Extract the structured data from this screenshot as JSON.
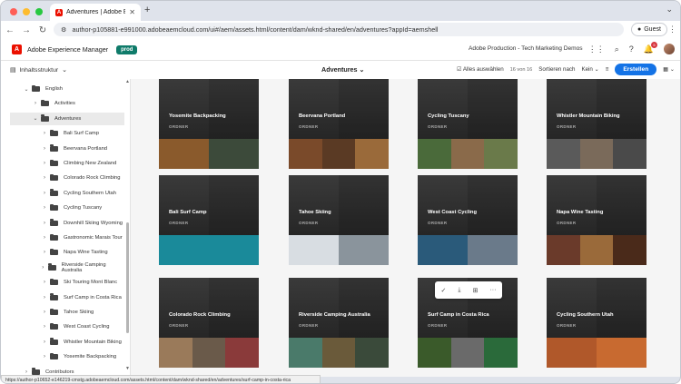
{
  "browser": {
    "tab_title": "Adventures | Adobe Experience",
    "url": "author-p105881-e991000.adobeaemcloud.com/ui#/aem/assets.html/content/dam/wknd-shared/en/adventures?appId=aemshell",
    "profile_label": "Guest"
  },
  "header": {
    "app_title": "Adobe Experience Manager",
    "env_badge": "prod",
    "org_name": "Adobe Production - Tech Marketing Demos",
    "notifications_count": "5"
  },
  "actionbar": {
    "rail_label": "Inhaltsstruktur",
    "breadcrumb": "Adventures",
    "select_all": "Alles auswählen",
    "count": "16 von 16",
    "sort_label": "Sortieren nach",
    "sort_value": "Kein",
    "create_label": "Erstellen"
  },
  "tree": {
    "items": [
      {
        "label": "English",
        "level": 1,
        "expanded": true
      },
      {
        "label": "Activities",
        "level": 2,
        "expanded": false
      },
      {
        "label": "Adventures",
        "level": 2,
        "expanded": true,
        "selected": true
      },
      {
        "label": "Bali Surf Camp",
        "level": 3
      },
      {
        "label": "Beervana Portland",
        "level": 3
      },
      {
        "label": "Climbing New Zealand",
        "level": 3
      },
      {
        "label": "Colorado Rock Climbing",
        "level": 3
      },
      {
        "label": "Cycling Southern Utah",
        "level": 3
      },
      {
        "label": "Cycling Tuscany",
        "level": 3
      },
      {
        "label": "Downhill Skiing Wyoming",
        "level": 3
      },
      {
        "label": "Gastronomic Marais Tour",
        "level": 3
      },
      {
        "label": "Napa Wine Tasting",
        "level": 3
      },
      {
        "label": "Riverside Camping Australia",
        "level": 3
      },
      {
        "label": "Ski Touring Mont Blanc",
        "level": 3
      },
      {
        "label": "Surf Camp in Costa Rica",
        "level": 3
      },
      {
        "label": "Tahoe Skiing",
        "level": 3
      },
      {
        "label": "West Coast Cycling",
        "level": 3
      },
      {
        "label": "Whistler Mountain Biking",
        "level": 3
      },
      {
        "label": "Yosemite Backpacking",
        "level": 3
      },
      {
        "label": "Contributors",
        "level": 1
      }
    ]
  },
  "cards": [
    {
      "name": "Yosemite Backpacking",
      "type": "ORDNER",
      "colors": [
        "#8a5a2c",
        "#3c4a3a"
      ]
    },
    {
      "name": "Beervana Portland",
      "type": "ORDNER",
      "colors": [
        "#7a4a2a",
        "#5a3a24",
        "#9a6a3a"
      ]
    },
    {
      "name": "Cycling Tuscany",
      "type": "ORDNER",
      "colors": [
        "#4a6a3a",
        "#8a6a4a",
        "#6a7a4a"
      ]
    },
    {
      "name": "Whistler Mountain Biking",
      "type": "ORDNER",
      "colors": [
        "#5a5a5a",
        "#7a6a5a",
        "#4a4a4a"
      ]
    },
    {
      "name": "Bali Surf Camp",
      "type": "ORDNER",
      "colors": [
        "#1a8a9a"
      ]
    },
    {
      "name": "Tahoe Skiing",
      "type": "ORDNER",
      "colors": [
        "#d8dde2",
        "#8a949c"
      ]
    },
    {
      "name": "West Coast Cycling",
      "type": "ORDNER",
      "colors": [
        "#2a5a7a",
        "#6a7a8a"
      ]
    },
    {
      "name": "Napa Wine Tasting",
      "type": "ORDNER",
      "colors": [
        "#6a3a2a",
        "#9a6a3a",
        "#4a2a1a"
      ]
    },
    {
      "name": "Colorado Rock Climbing",
      "type": "ORDNER",
      "colors": [
        "#9a7a5a",
        "#6a5a4a",
        "#8a3a3a"
      ]
    },
    {
      "name": "Riverside Camping Australia",
      "type": "ORDNER",
      "colors": [
        "#4a7a6a",
        "#6a5a3a",
        "#3a4a3a"
      ]
    },
    {
      "name": "Surf Camp in Costa Rica",
      "type": "ORDNER",
      "colors": [
        "#3a5a2a",
        "#6a6a6a",
        "#2a6a3a"
      ]
    },
    {
      "name": "Cycling Southern Utah",
      "type": "ORDNER",
      "colors": [
        "#b0582a",
        "#c86a30"
      ]
    }
  ],
  "status_url": "https://author-p10652-e146219-cmstg.adobeaemcloud.com/assets.html/content/dam/wknd-shared/en/adventures/surf-camp-in-costa-rica"
}
